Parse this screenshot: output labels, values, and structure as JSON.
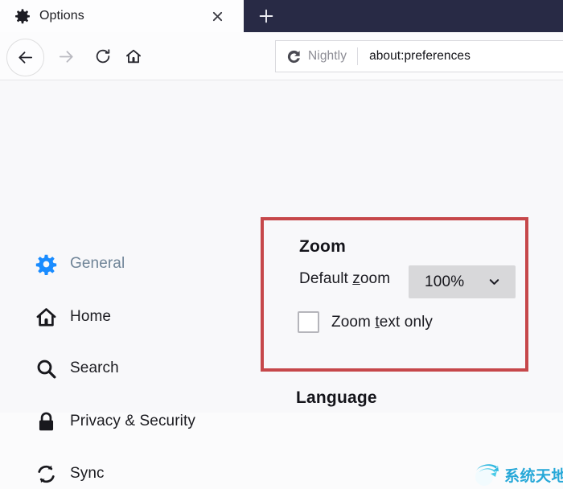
{
  "window": {
    "tab": {
      "title": "Options",
      "favicon": "gear-icon",
      "close_label": "×"
    },
    "newtab_label": "+"
  },
  "toolbar": {
    "back": "back-arrow-icon",
    "forward": "forward-arrow-icon",
    "reload": "reload-icon",
    "home": "home-icon"
  },
  "urlbar": {
    "identity_label": "Nightly",
    "identity_icon": "nightly-logo-icon",
    "url": "about:preferences"
  },
  "sidebar": {
    "items": [
      {
        "label": "General",
        "icon": "gear-icon",
        "selected": true
      },
      {
        "label": "Home",
        "icon": "home-icon",
        "selected": false
      },
      {
        "label": "Search",
        "icon": "search-icon",
        "selected": false
      },
      {
        "label": "Privacy & Security",
        "icon": "lock-icon",
        "selected": false
      },
      {
        "label": "Sync",
        "icon": "sync-icon",
        "selected": false
      }
    ]
  },
  "zoom_panel": {
    "heading": "Zoom",
    "default_zoom_label_pre": "Default ",
    "default_zoom_label_key": "z",
    "default_zoom_label_post": "oom",
    "default_zoom_value": "100%",
    "chevron": "chevron-down-icon",
    "checkbox_label_pre": "Zoom ",
    "checkbox_label_key": "t",
    "checkbox_label_post": "ext only",
    "checkbox_checked": false,
    "highlight_color": "#c6474a"
  },
  "language_section": {
    "heading": "Language"
  },
  "watermark": {
    "text": "系统天地",
    "logo": "globe-arrow-icon",
    "color": "#27a8d8"
  }
}
